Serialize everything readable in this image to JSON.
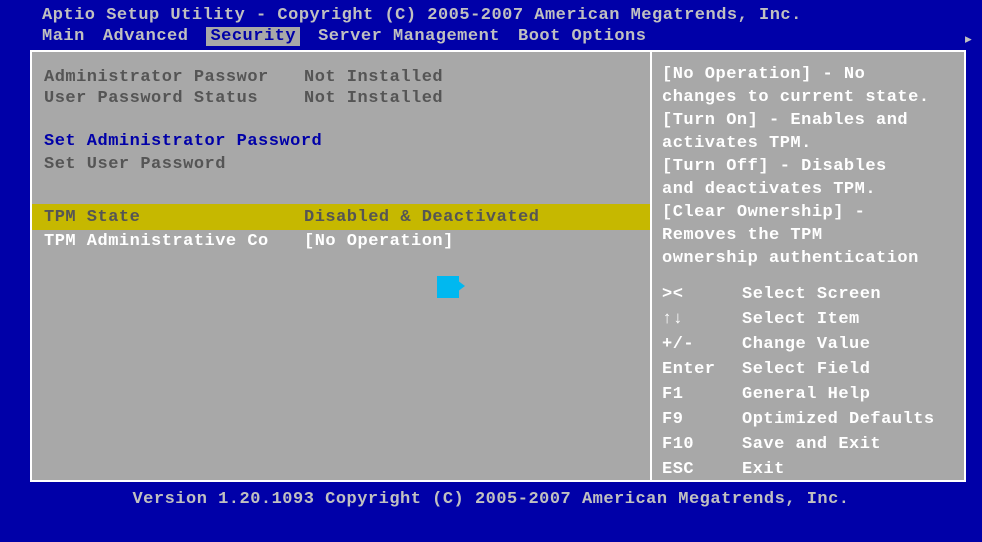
{
  "header": {
    "title": "Aptio Setup Utility - Copyright (C) 2005-2007 American Megatrends, Inc."
  },
  "tabs": {
    "items": [
      {
        "label": "Main"
      },
      {
        "label": "Advanced"
      },
      {
        "label": "Security"
      },
      {
        "label": "Server Management"
      },
      {
        "label": "Boot Options"
      }
    ],
    "active_index": 2
  },
  "left": {
    "admin_pw_label": "Administrator Passwor",
    "admin_pw_value": "Not Installed",
    "user_pw_label": "User Password Status",
    "user_pw_value": "Not Installed",
    "set_admin": "Set Administrator Password",
    "set_user": "Set User Password",
    "tpm_state_label": "TPM State",
    "tpm_state_value": "Disabled & Deactivated",
    "tpm_admin_label": "TPM Administrative Co",
    "tpm_admin_value": "[No Operation]"
  },
  "help": {
    "text": "[No Operation] - No\nchanges to current state.\n[Turn On] - Enables and\nactivates TPM.\n[Turn Off] - Disables\nand deactivates TPM.\n[Clear Ownership] -\nRemoves the TPM\nownership authentication"
  },
  "keys": [
    {
      "k": "><",
      "d": "Select Screen"
    },
    {
      "k": "↑↓",
      "d": "Select Item"
    },
    {
      "k": "+/-",
      "d": "Change Value"
    },
    {
      "k": "Enter",
      "d": "Select Field"
    },
    {
      "k": "F1",
      "d": "General Help"
    },
    {
      "k": "F9",
      "d": "Optimized Defaults"
    },
    {
      "k": "F10",
      "d": "Save and Exit"
    },
    {
      "k": "ESC",
      "d": "Exit"
    }
  ],
  "footer": {
    "text": "Version 1.20.1093 Copyright (C) 2005-2007 American Megatrends, Inc."
  }
}
